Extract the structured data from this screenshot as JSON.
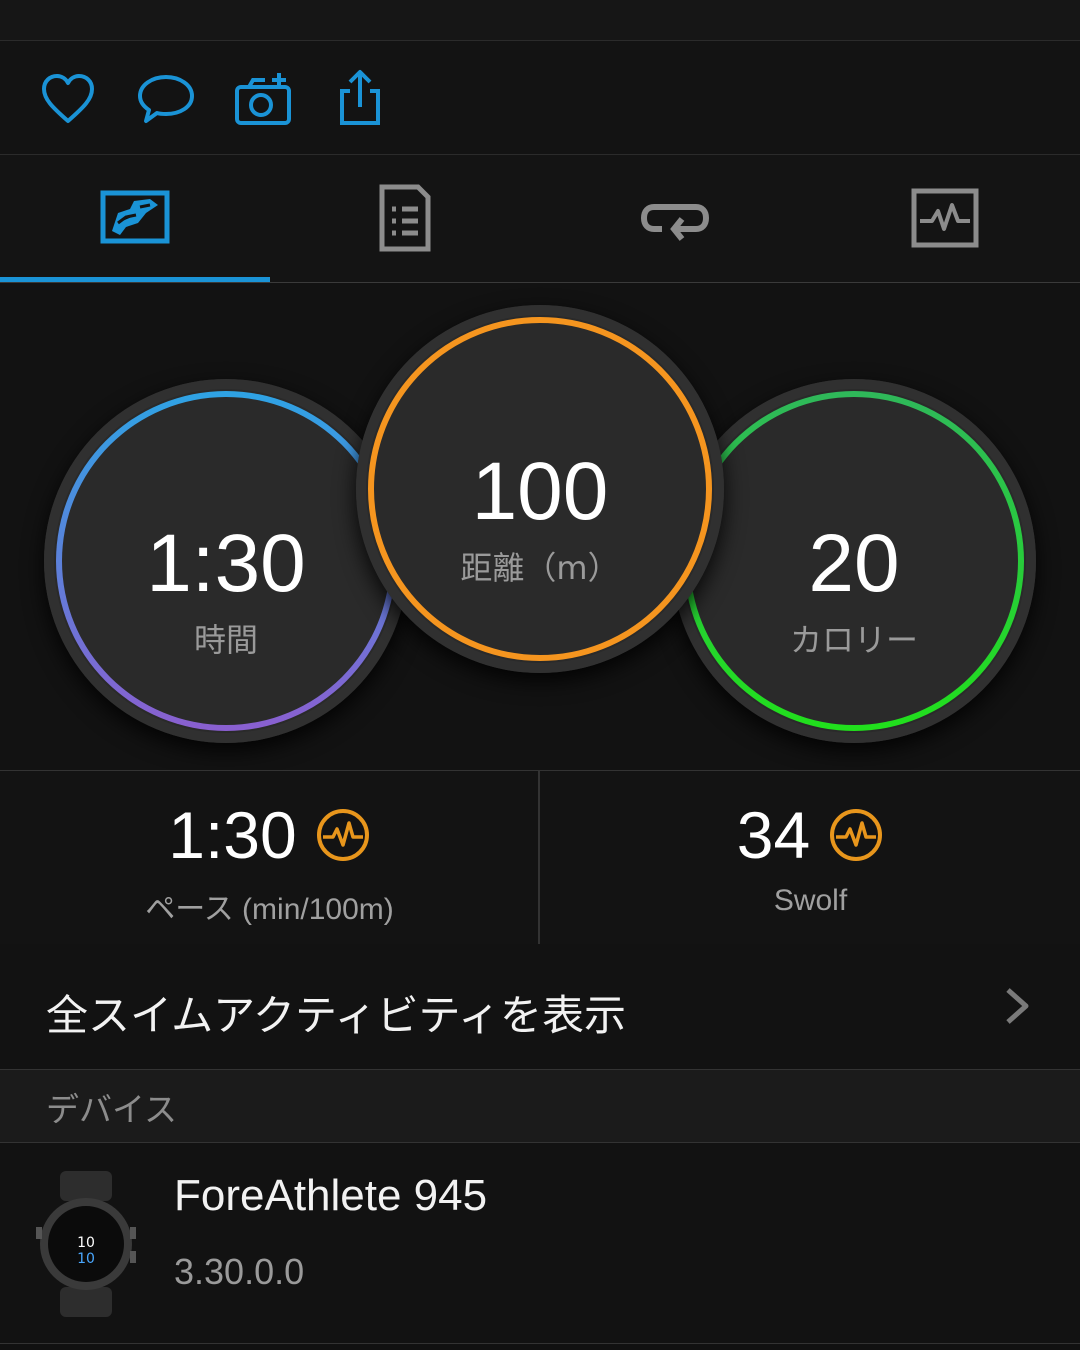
{
  "colors": {
    "accent": "#1a93d6",
    "time_ring_top": "#2ea3e4",
    "time_ring_bottom": "#8a5fd0",
    "distance_ring": "#f5951f",
    "calories_ring_top": "#2fb85a",
    "calories_ring_bottom": "#21e01c",
    "hr_zone_icon": "#e8961c"
  },
  "action_bar": {
    "icons": [
      "heart-icon",
      "comment-icon",
      "add-photo-icon",
      "share-icon"
    ]
  },
  "tabs": [
    {
      "icon": "map-overview-icon",
      "active": true
    },
    {
      "icon": "details-list-icon",
      "active": false
    },
    {
      "icon": "laps-icon",
      "active": false
    },
    {
      "icon": "charts-icon",
      "active": false
    }
  ],
  "summary": {
    "time": {
      "value": "1:30",
      "label": "時間"
    },
    "distance": {
      "value": "100",
      "label": "距離（m）"
    },
    "calories": {
      "value": "20",
      "label": "カロリー"
    }
  },
  "stats": {
    "pace": {
      "value": "1:30",
      "label": "ペース (min/100m)",
      "icon": "hr-zone-icon"
    },
    "swolf": {
      "value": "34",
      "label": "Swolf",
      "icon": "hr-zone-icon"
    }
  },
  "all_activities_label": "全スイムアクティビティを表示",
  "device_section": {
    "header": "デバイス",
    "name": "ForeAthlete 945",
    "version": "3.30.0.0"
  }
}
